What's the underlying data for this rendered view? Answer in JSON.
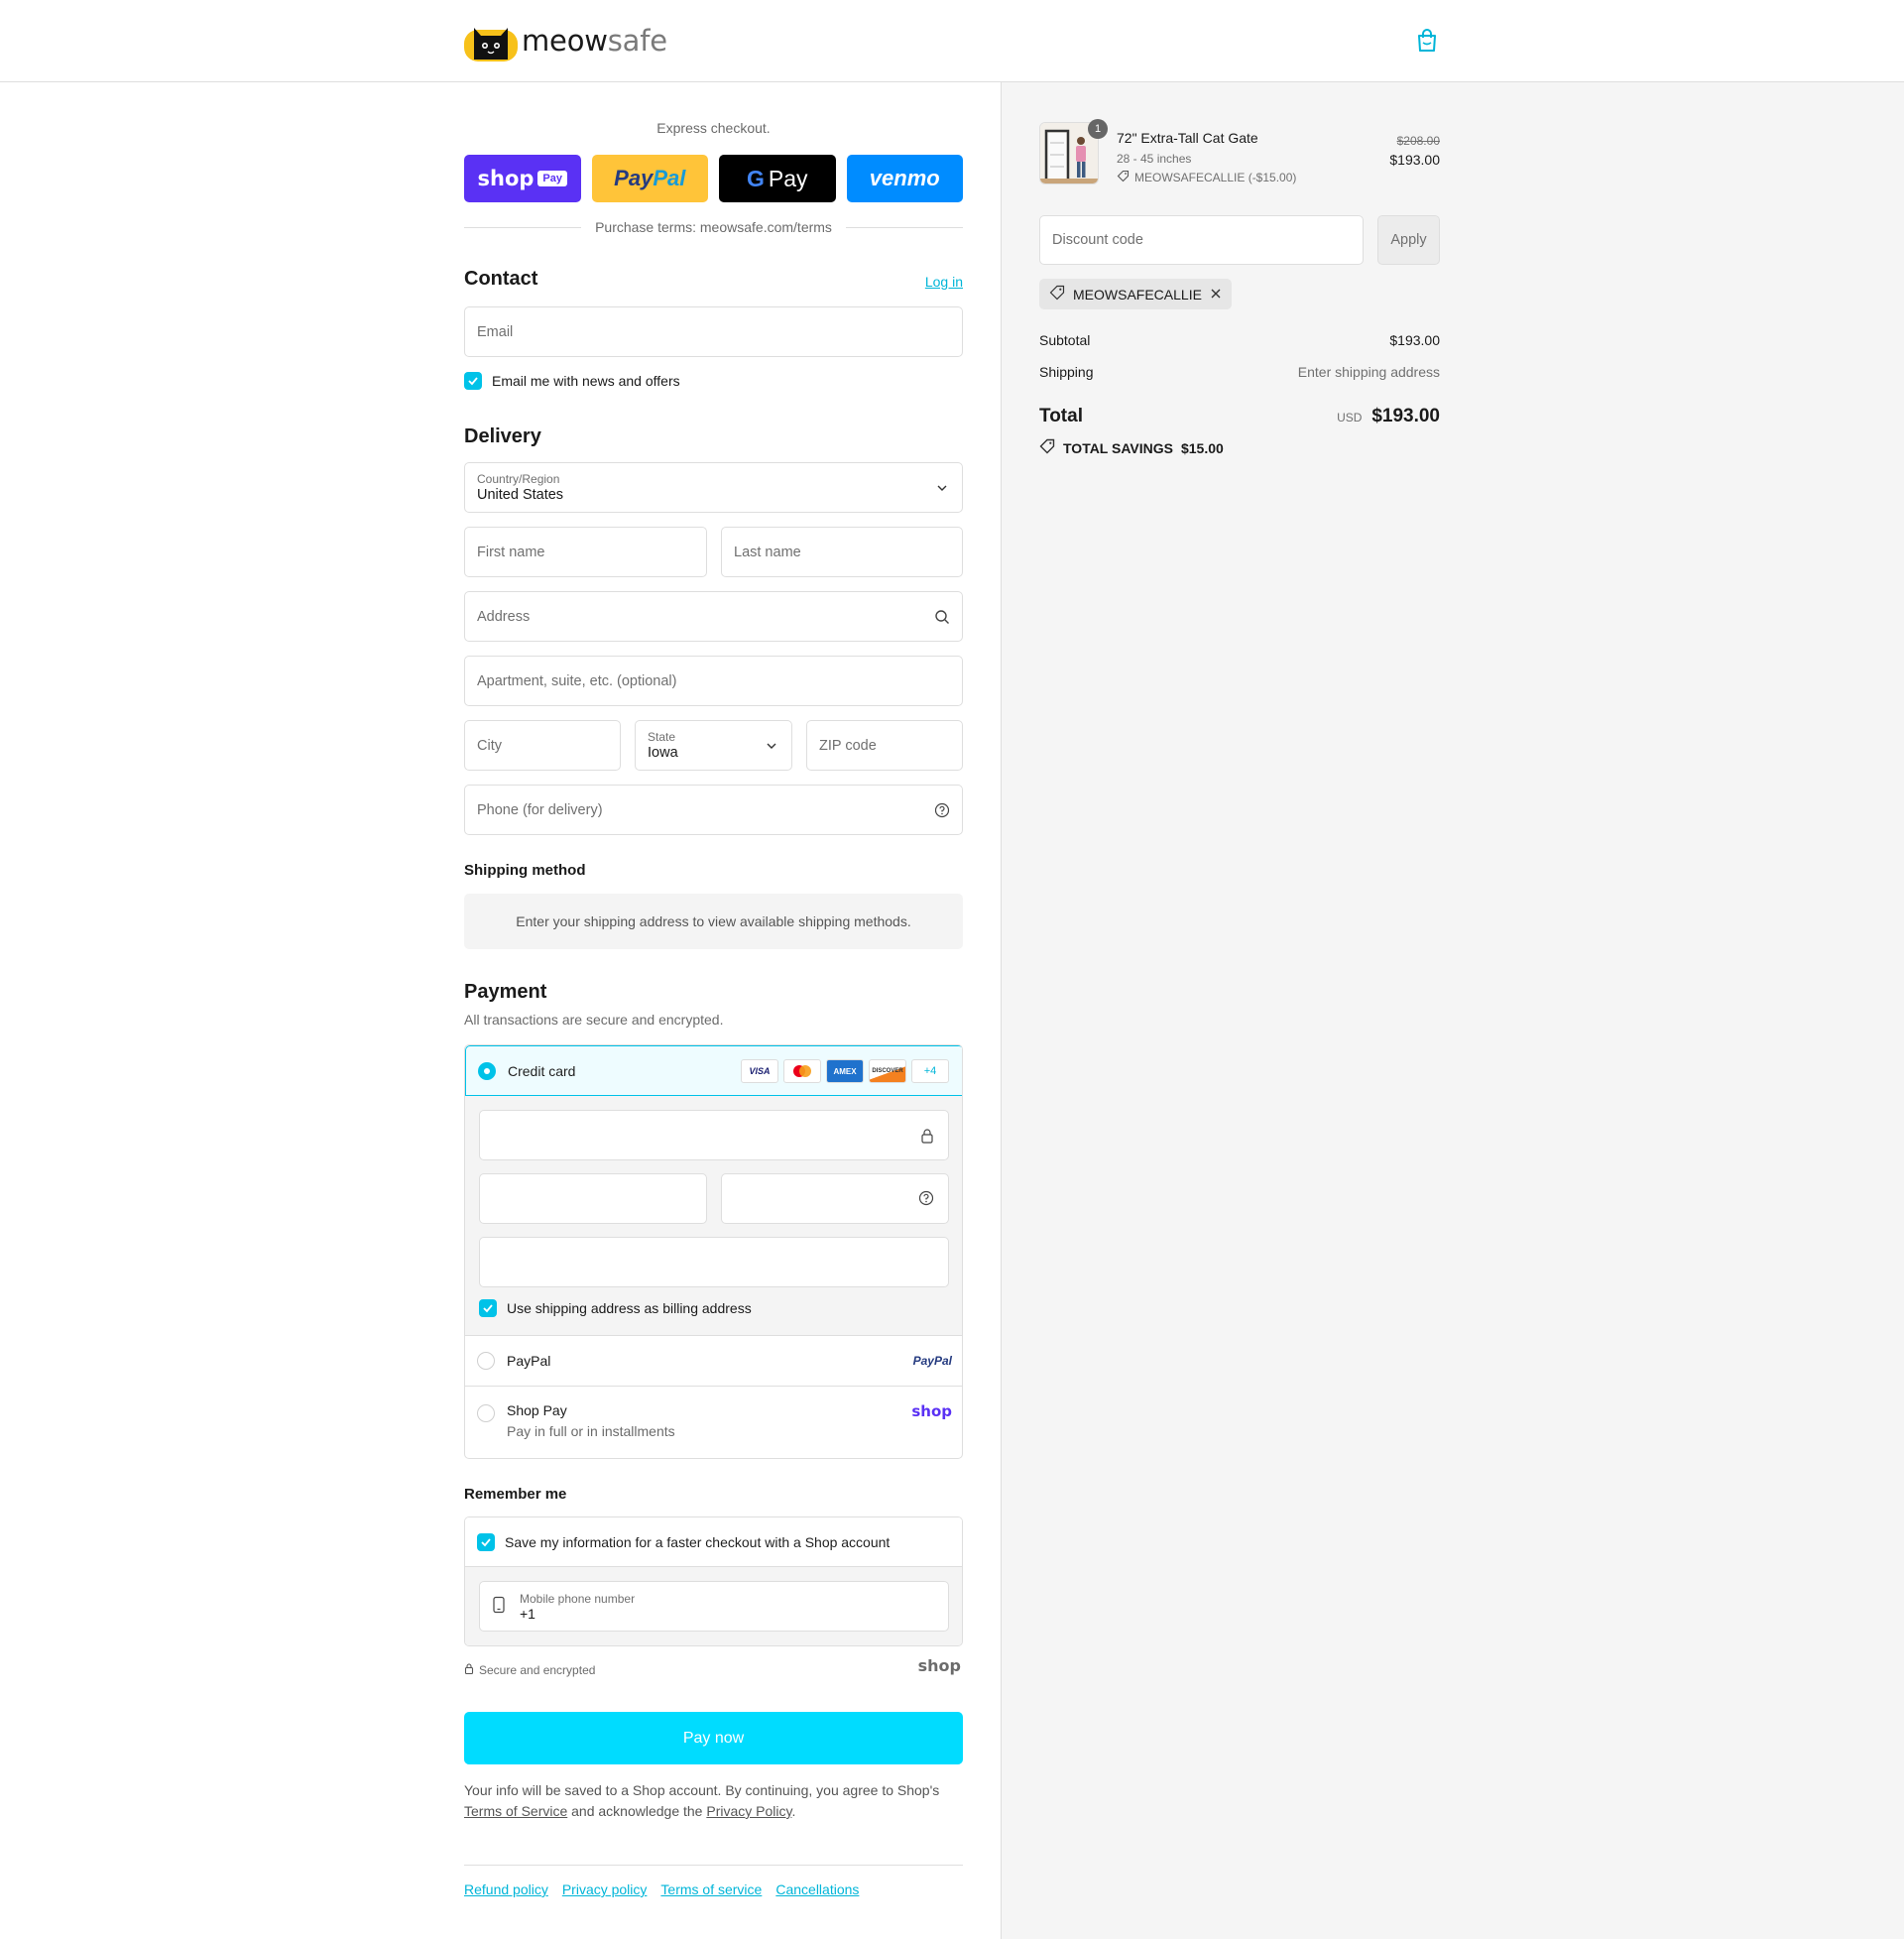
{
  "header": {
    "brand_part1": "meow",
    "brand_part2": "safe"
  },
  "express": {
    "title": "Express checkout.",
    "buttons": [
      "shop Pay",
      "PayPal",
      "G Pay",
      "venmo"
    ],
    "terms": "Purchase terms: meowsafe.com/terms"
  },
  "contact": {
    "title": "Contact",
    "login": "Log in",
    "email_placeholder": "Email",
    "newsletter": "Email me with news and offers"
  },
  "delivery": {
    "title": "Delivery",
    "country_label": "Country/Region",
    "country_value": "United States",
    "first_name": "First name",
    "last_name": "Last name",
    "address": "Address",
    "apartment": "Apartment, suite, etc. (optional)",
    "city": "City",
    "state_label": "State",
    "state_value": "Iowa",
    "zip": "ZIP code",
    "phone": "Phone (for delivery)"
  },
  "shipping": {
    "title": "Shipping method",
    "message": "Enter your shipping address to view available shipping methods."
  },
  "payment": {
    "title": "Payment",
    "subtitle": "All transactions are secure and encrypted.",
    "credit_card": "Credit card",
    "card_brands": [
      "VISA",
      "MC",
      "AMEX",
      "DISCOVER"
    ],
    "more_cards": "+4",
    "billing_same": "Use shipping address as billing address",
    "paypal": "PayPal",
    "paypal_logo": "PayPal",
    "shoppay": "Shop Pay",
    "shoppay_sub": "Pay in full or in installments",
    "shop_logo": "shop"
  },
  "remember": {
    "title": "Remember me",
    "save": "Save my information for a faster checkout with a Shop account",
    "phone_label": "Mobile phone number",
    "phone_value": "+1",
    "secure": "Secure and encrypted",
    "shop_logo": "shop"
  },
  "pay_now": "Pay now",
  "legal": {
    "text1": "Your info will be saved to a Shop account. By continuing, you agree to Shop's",
    "tos": "Terms of Service",
    "text2": "and acknowledge the",
    "privacy": "Privacy Policy",
    "text3": "."
  },
  "footer_links": [
    "Refund policy",
    "Privacy policy",
    "Terms of service",
    "Cancellations"
  ],
  "summary": {
    "product_name": "72\" Extra-Tall Cat Gate",
    "product_variant": "28 - 45 inches",
    "product_discount": "MEOWSAFECALLIE (-$15.00)",
    "quantity": "1",
    "old_price": "$208.00",
    "new_price": "$193.00",
    "discount_placeholder": "Discount code",
    "apply": "Apply",
    "applied_code": "MEOWSAFECALLIE",
    "subtotal_label": "Subtotal",
    "subtotal_value": "$193.00",
    "shipping_label": "Shipping",
    "shipping_value": "Enter shipping address",
    "total_label": "Total",
    "currency": "USD",
    "total_value": "$193.00",
    "savings_label": "TOTAL SAVINGS",
    "savings_value": "$15.00"
  },
  "colors": {
    "accent": "#00c2e8",
    "pay_button": "#00dcff",
    "shop_purple": "#5a31f4",
    "paypal_yellow": "#ffc439",
    "venmo_blue": "#008cff"
  }
}
